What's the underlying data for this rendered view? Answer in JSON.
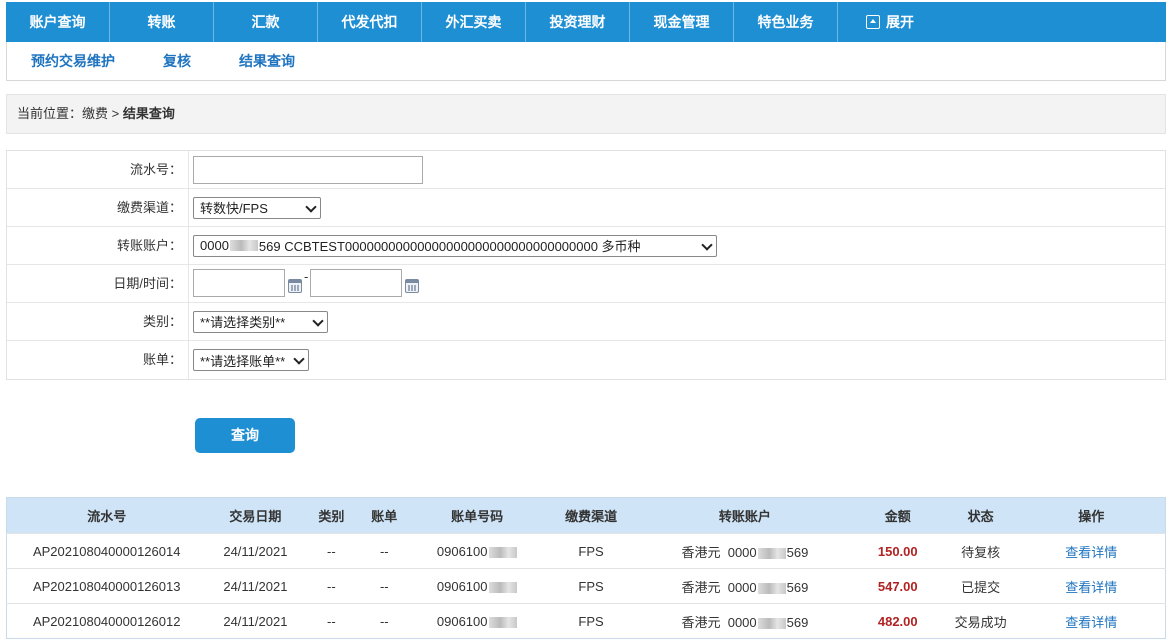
{
  "topnav": {
    "items": [
      "账户查询",
      "转账",
      "汇款",
      "代发代扣",
      "外汇买卖",
      "投资理财",
      "现金管理",
      "特色业务"
    ],
    "expand_label": "展开"
  },
  "subnav": {
    "items": [
      "预约交易维护",
      "复核",
      "结果查询"
    ]
  },
  "breadcrumb": {
    "prefix": "当前位置：缴费 > ",
    "current": "结果查询"
  },
  "form": {
    "serial_label": "流水号：",
    "serial_value": "",
    "channel_label": "缴费渠道：",
    "channel_value": "转数快/FPS",
    "account_label": "转账账户：",
    "account_prefix": "0000",
    "account_suffix": "569 CCBTEST00000000000000000000000000000000000 多币种",
    "date_label": "日期/时间：",
    "date_from": "",
    "date_to": "",
    "date_sep": "-",
    "category_label": "类别：",
    "category_value": "**请选择类别**",
    "bill_label": "账单：",
    "bill_value": "**请选择账单**"
  },
  "query_button": "查询",
  "table": {
    "headers": [
      "流水号",
      "交易日期",
      "类别",
      "账单",
      "账单号码",
      "缴费渠道",
      "转账账户",
      "金额",
      "状态",
      "操作"
    ],
    "rows": [
      {
        "serial": "AP202108040000126014",
        "date": "24/11/2021",
        "category": "--",
        "bill": "--",
        "bill_no": "0906100",
        "channel": "FPS",
        "currency": "香港元",
        "acct_prefix": "0000",
        "acct_suffix": "569",
        "amount": "150.00",
        "status": "待复核",
        "action": "查看详情"
      },
      {
        "serial": "AP202108040000126013",
        "date": "24/11/2021",
        "category": "--",
        "bill": "--",
        "bill_no": "0906100",
        "channel": "FPS",
        "currency": "香港元",
        "acct_prefix": "0000",
        "acct_suffix": "569",
        "amount": "547.00",
        "status": "已提交",
        "action": "查看详情"
      },
      {
        "serial": "AP202108040000126012",
        "date": "24/11/2021",
        "category": "--",
        "bill": "--",
        "bill_no": "0906100",
        "channel": "FPS",
        "currency": "香港元",
        "acct_prefix": "0000",
        "acct_suffix": "569",
        "amount": "482.00",
        "status": "交易成功",
        "action": "查看详情"
      }
    ]
  }
}
